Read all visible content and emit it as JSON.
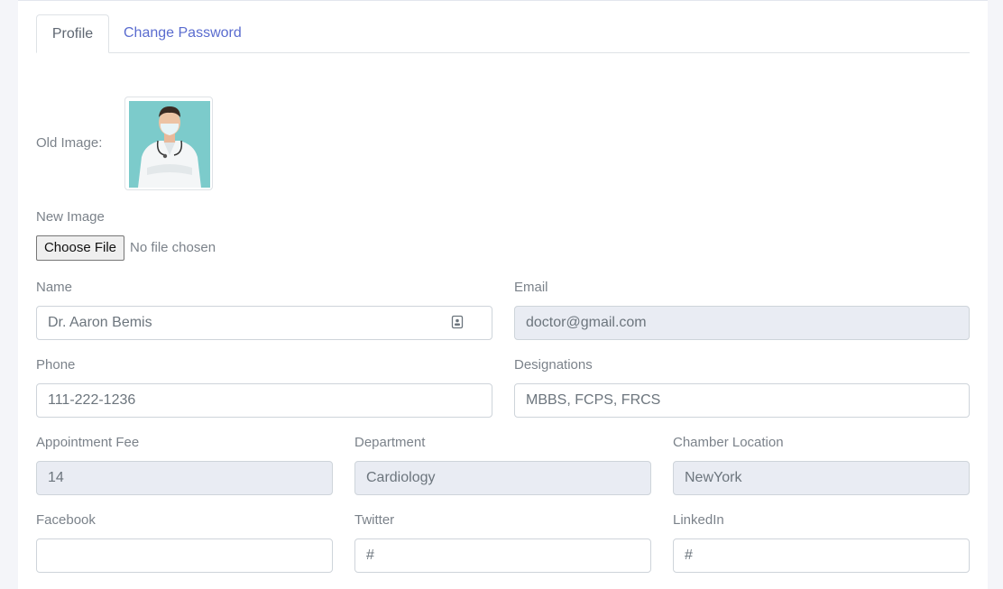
{
  "tabs": {
    "profile": "Profile",
    "change_password": "Change Password"
  },
  "profile": {
    "old_image_label": "Old Image:",
    "new_image_label": "New Image",
    "file_button": "Choose File",
    "file_status": "No file chosen",
    "fields": {
      "name": {
        "label": "Name",
        "value": "Dr. Aaron Bemis"
      },
      "email": {
        "label": "Email",
        "value": "doctor@gmail.com"
      },
      "phone": {
        "label": "Phone",
        "value": "111-222-1236"
      },
      "designations": {
        "label": "Designations",
        "value": "MBBS, FCPS, FRCS"
      },
      "appointment_fee": {
        "label": "Appointment Fee",
        "value": "14"
      },
      "department": {
        "label": "Department",
        "value": "Cardiology"
      },
      "chamber_location": {
        "label": "Chamber Location",
        "value": "NewYork"
      },
      "facebook": {
        "label": "Facebook",
        "value": ""
      },
      "twitter": {
        "label": "Twitter",
        "value": "#"
      },
      "linkedin": {
        "label": "LinkedIn",
        "value": "#"
      }
    }
  },
  "colors": {
    "accent": "#5a6ccf",
    "readonly_bg": "#e9ecf3",
    "photo_bg": "#7ccbcb"
  }
}
